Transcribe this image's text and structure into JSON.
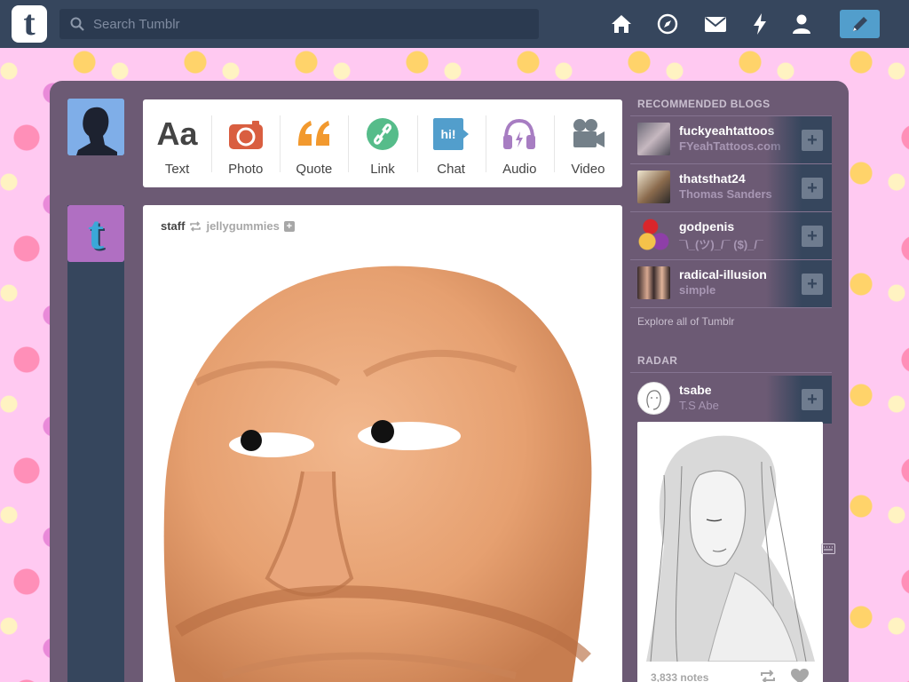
{
  "header": {
    "logo_letter": "t",
    "search_placeholder": "Search Tumblr",
    "nav_icons": [
      "home-icon",
      "explore-icon",
      "inbox-icon",
      "activity-icon",
      "account-icon"
    ],
    "compose_icon": "pencil-icon"
  },
  "post_types": [
    {
      "label": "Text",
      "icon": "text-icon",
      "color": "#444444"
    },
    {
      "label": "Photo",
      "icon": "camera-icon",
      "color": "#d95e40"
    },
    {
      "label": "Quote",
      "icon": "quote-icon",
      "color": "#f2992e"
    },
    {
      "label": "Link",
      "icon": "link-icon",
      "color": "#56bc8a"
    },
    {
      "label": "Chat",
      "icon": "chat-icon",
      "color": "#529ecc"
    },
    {
      "label": "Audio",
      "icon": "headphones-icon",
      "color": "#a77dc2"
    },
    {
      "label": "Video",
      "icon": "video-camera-icon",
      "color": "#748089"
    }
  ],
  "text_icon_glyph": "Aa",
  "chat_icon_glyph": "hi!",
  "post": {
    "author": "staff",
    "reblogged_from": "jellygummies"
  },
  "sidebar": {
    "recommended_heading": "RECOMMENDED BLOGS",
    "blogs": [
      {
        "name": "fuckyeahtattoos",
        "title": "FYeahTattoos.com"
      },
      {
        "name": "thatsthat24",
        "title": "Thomas Sanders"
      },
      {
        "name": "godpenis",
        "title": "¯\\_(ツ)_/¯ ($)_/¯"
      },
      {
        "name": "radical-illusion",
        "title": "simple"
      }
    ],
    "explore_link": "Explore all of Tumblr",
    "radar_heading": "RADAR",
    "radar_blog": {
      "name": "tsabe",
      "title": "T.S Abe"
    },
    "radar_notes": "3,833 notes"
  },
  "colors": {
    "navy": "#36465d",
    "panel": "#6c5a74",
    "compose": "#529ecc"
  }
}
